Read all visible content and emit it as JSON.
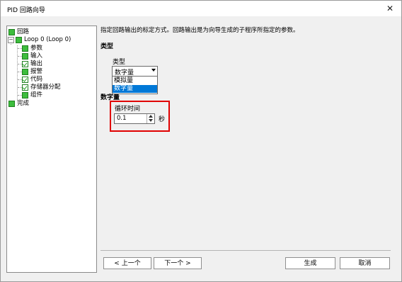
{
  "window": {
    "title": "PID 回路向导",
    "close_glyph": "✕"
  },
  "tree": {
    "root": "回路",
    "loop": "Loop 0 (Loop 0)",
    "children": [
      "参数",
      "输入",
      "输出",
      "报警",
      "代码",
      "存储器分配",
      "组件"
    ],
    "finish": "完成"
  },
  "main": {
    "description": "指定回路输出的标定方式。回路输出是为向导生成的子程序所指定的参数。",
    "type_section": "类型",
    "type_label": "类型",
    "type_selected": "数字量",
    "type_options": [
      "模拟量",
      "数字量"
    ],
    "digital_section": "数字量",
    "cycle_label": "循环时间",
    "cycle_value": "0.1",
    "cycle_unit": "秒"
  },
  "footer": {
    "prev": "< 上一个",
    "next": "下一个 >",
    "generate": "生成",
    "cancel": "取消"
  }
}
